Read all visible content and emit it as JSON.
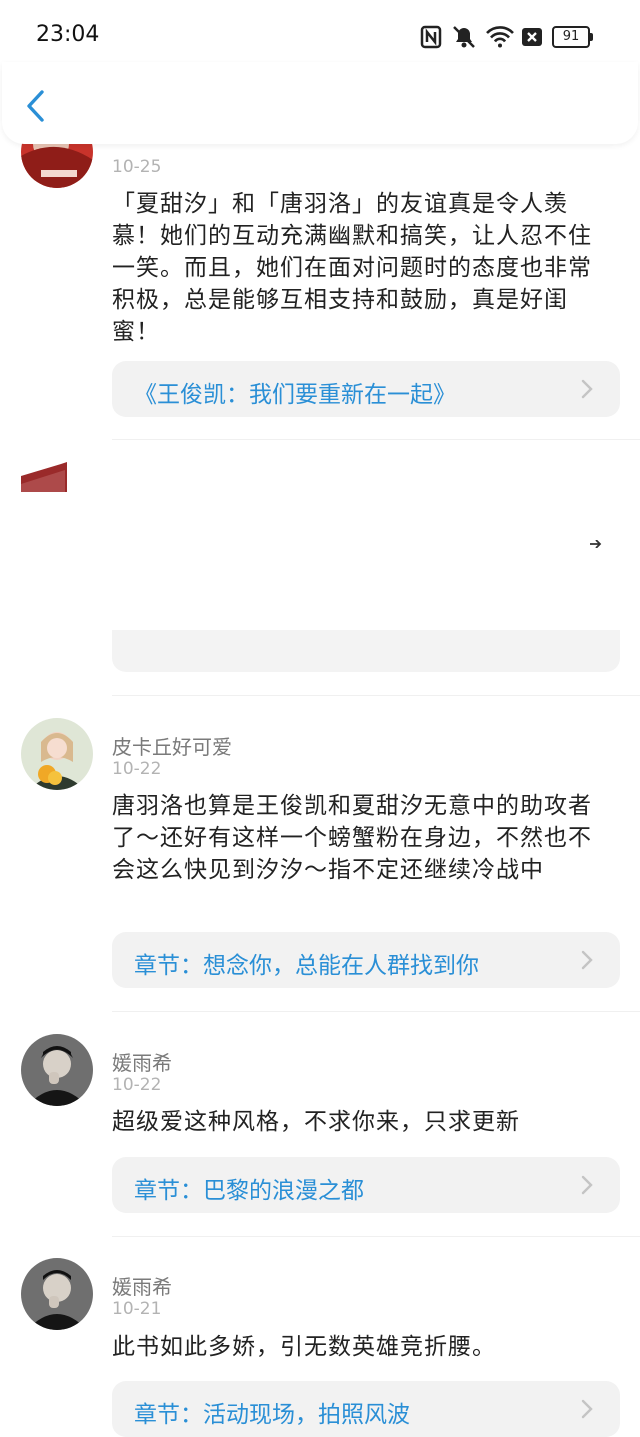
{
  "status_bar": {
    "time": "23:04",
    "battery": "91"
  },
  "comments": [
    {
      "date": "10-25",
      "text": "「夏甜汐」和「唐羽洛」的友谊真是令人羡慕！她们的互动充满幽默和搞笑，让人忍不住一笑。而且，她们在面对问题时的态度也非常积极，总是能够互相支持和鼓励，真是好闺蜜！",
      "chapter": "《王俊凯：我们要重新在一起》"
    },
    {
      "username": "皮卡丘好可爱",
      "date": "10-22",
      "text": "唐羽洛也算是王俊凯和夏甜汐无意中的助攻者了～还好有这样一个螃蟹粉在身边，不然也不会这么快见到汐汐～指不定还继续冷战中",
      "chapter": "章节：想念你，总能在人群找到你"
    },
    {
      "username": "媛雨希",
      "date": "10-22",
      "text": "超级爱这种风格，不求你来，只求更新",
      "chapter": "章节：巴黎的浪漫之都"
    },
    {
      "username": "媛雨希",
      "date": "10-21",
      "text": "此书如此多娇，引无数英雄竞折腰。",
      "chapter": "章节：活动现场，拍照风波"
    }
  ]
}
